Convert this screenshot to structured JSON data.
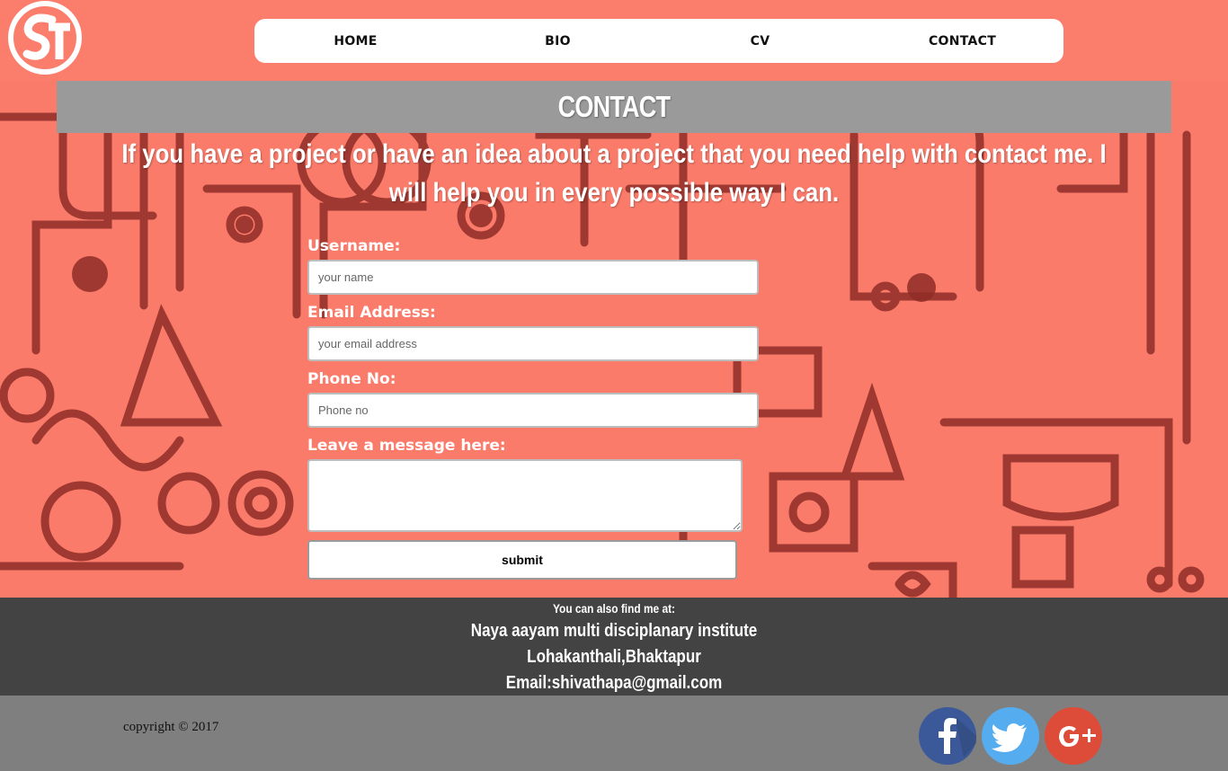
{
  "nav": {
    "items": [
      {
        "label": "HOME"
      },
      {
        "label": "BIO"
      },
      {
        "label": "CV"
      },
      {
        "label": "CONTACT"
      }
    ]
  },
  "page": {
    "title": "CONTACT",
    "intro": "If you have a project or have an idea about a project that you need help with contact me. I will help you in every possible way I can."
  },
  "form": {
    "username_label": "Username:",
    "username_placeholder": "your name",
    "email_label": "Email Address:",
    "email_placeholder": "your email address",
    "phone_label": "Phone No:",
    "phone_placeholder": "Phone no",
    "message_label": "Leave a message here:",
    "submit_label": "submit"
  },
  "footer": {
    "find_me": "You can also find me at:",
    "org": "Naya aayam multi disciplanary institute",
    "address": "Lohakanthali,Bhaktapur",
    "email": "Email:shivathapa@gmail.com",
    "copyright": "copyright © 2017"
  },
  "social": [
    {
      "name": "facebook-icon",
      "color": "#3b5998"
    },
    {
      "name": "twitter-icon",
      "color": "#55acee"
    },
    {
      "name": "google-plus-icon",
      "color": "#dd4b39"
    }
  ],
  "colors": {
    "background": "#fb7b6b",
    "art": "#8e2d27",
    "title_bar": "#9a9a9a",
    "footer_dark": "#434343",
    "footer_grey": "#7f7f7f"
  }
}
